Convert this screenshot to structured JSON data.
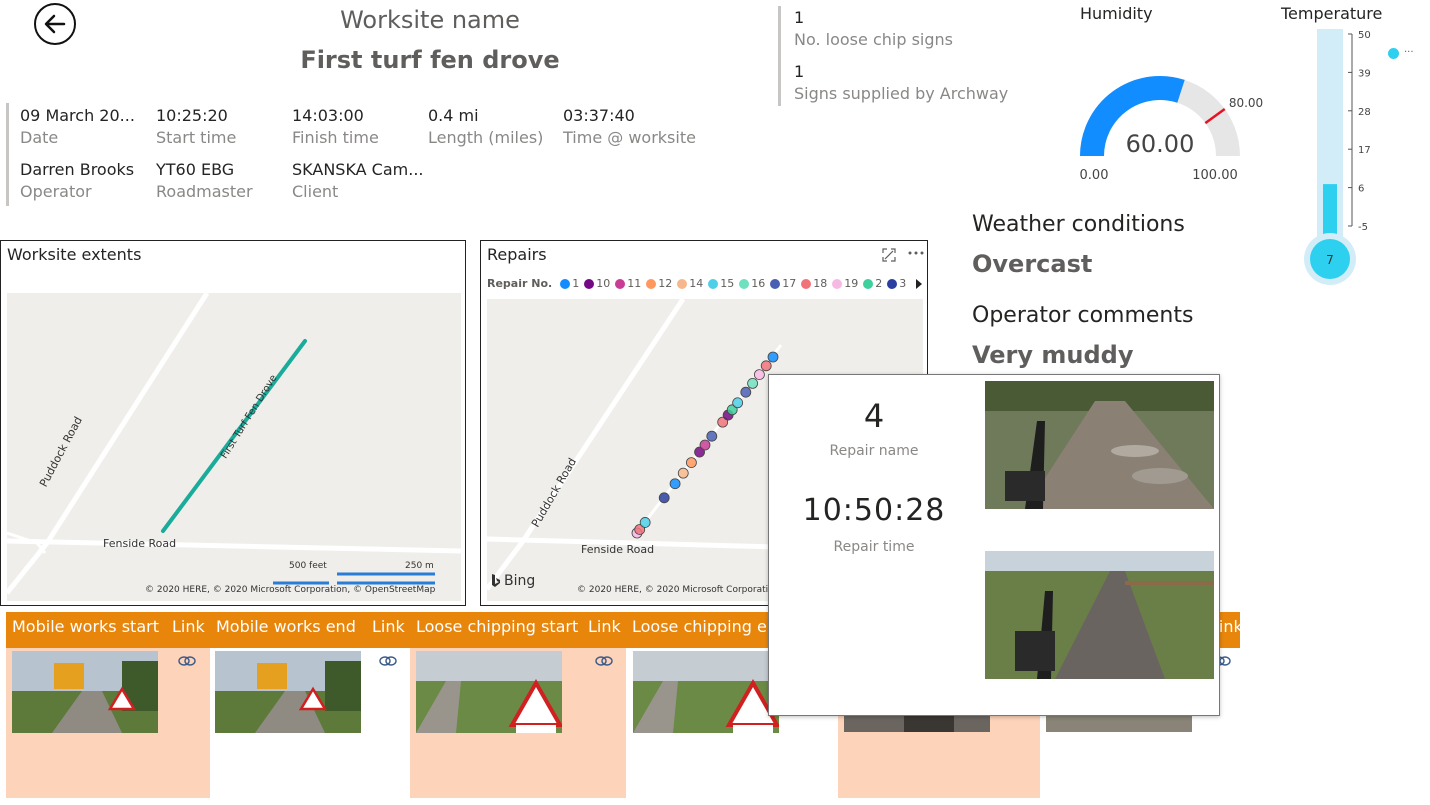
{
  "header": {
    "worksite_label": "Worksite name",
    "worksite_name": "First turf fen drove"
  },
  "details": {
    "row1": [
      {
        "value": "09 March 20...",
        "label": "Date"
      },
      {
        "value": "10:25:20",
        "label": "Start time"
      },
      {
        "value": "14:03:00",
        "label": "Finish time"
      },
      {
        "value": "0.4 mi",
        "label": "Length (miles)"
      },
      {
        "value": "03:37:40",
        "label": "Time @ worksite"
      }
    ],
    "row2": [
      {
        "value": "Darren Brooks",
        "label": "Operator"
      },
      {
        "value": "YT60 EBG",
        "label": "Roadmaster"
      },
      {
        "value": "SKANSKA Cam...",
        "label": "Client"
      }
    ]
  },
  "signs": [
    {
      "value": "1",
      "label": "No. loose chip signs"
    },
    {
      "value": "1",
      "label": "Signs supplied by Archway"
    }
  ],
  "humidity": {
    "title": "Humidity",
    "value": 60,
    "value_text": "60.00",
    "min_text": "0.00",
    "max_text": "100.00",
    "target_text": "80.00",
    "min": 0,
    "max": 100,
    "target": 80,
    "fill_color": "#118dff",
    "track_color": "#e6e6e6",
    "target_color": "#e81123"
  },
  "temperature": {
    "title": "Temperature",
    "value": 7,
    "value_text": "7",
    "ticks": [
      "50",
      "39",
      "28",
      "17",
      "6",
      "-5"
    ],
    "min": -5,
    "max": 50,
    "legend_marker": "...",
    "fill_color": "#2ed0f0",
    "tube_color": "#d2edf7"
  },
  "weather": {
    "label": "Weather conditions",
    "value": "Overcast"
  },
  "comments": {
    "label": "Operator comments",
    "value": "Very muddy"
  },
  "extents_map": {
    "title": "Worksite extents",
    "roads": [
      "Puddock Road",
      "Fenside Road",
      "First Turf Fen Drove"
    ],
    "scale": [
      "500 feet",
      "250 m"
    ],
    "credit": "© 2020 HERE, © 2020 Microsoft Corporation, © OpenStreetMap",
    "line_color": "#1aab9b"
  },
  "repairs_map": {
    "title": "Repairs",
    "legend_label": "Repair No.",
    "legend": [
      {
        "label": "1",
        "color": "#118dff"
      },
      {
        "label": "10",
        "color": "#750985"
      },
      {
        "label": "11",
        "color": "#c83d95"
      },
      {
        "label": "12",
        "color": "#ff985e"
      },
      {
        "label": "14",
        "color": "#f7b78c"
      },
      {
        "label": "15",
        "color": "#4ecfe8"
      },
      {
        "label": "16",
        "color": "#6fe0c0"
      },
      {
        "label": "17",
        "color": "#4a5fb4"
      },
      {
        "label": "18",
        "color": "#f0737a"
      },
      {
        "label": "19",
        "color": "#f7b9e3"
      },
      {
        "label": "2",
        "color": "#3ed09d"
      },
      {
        "label": "3",
        "color": "#2b3fa0"
      }
    ],
    "roads": [
      "Puddock Road",
      "Fenside Road"
    ],
    "credit": "© 2020 HERE, © 2020 Microsoft Corporation, © OpenStreetMap",
    "bing": "Bing"
  },
  "tooltip": {
    "repair_name": "4",
    "repair_name_label": "Repair name",
    "repair_time": "10:50:28",
    "repair_time_label": "Repair time"
  },
  "table": {
    "headers": [
      "Mobile works start",
      "Link",
      "Mobile works end",
      "Link",
      "Loose chipping start",
      "Link",
      "Loose chipping e",
      "Link"
    ]
  },
  "colors": {
    "header_orange": "#e8860c",
    "peach": "#fdd3b9"
  }
}
